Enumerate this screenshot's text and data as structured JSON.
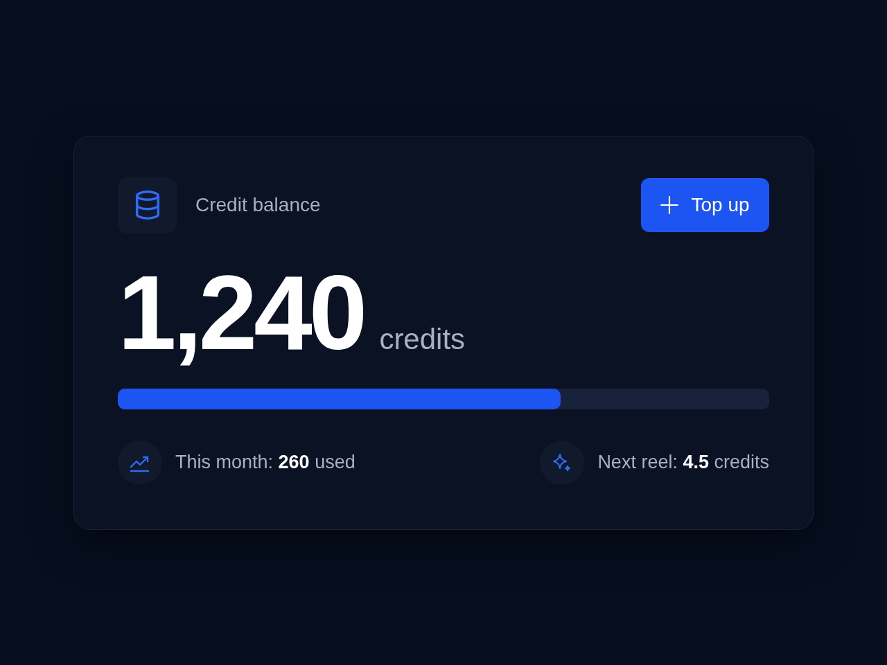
{
  "card": {
    "title": "Credit balance",
    "top_up_button": {
      "label": "Top up"
    },
    "balance": {
      "value": "1,240",
      "unit": "credits"
    },
    "usage_bar": {
      "level": 0.68
    },
    "stats": [
      {
        "kind": "trend",
        "text": "This month: **260** used"
      },
      {
        "kind": "sparkle",
        "text": "Next reel: **4.5** credits"
      }
    ]
  }
}
